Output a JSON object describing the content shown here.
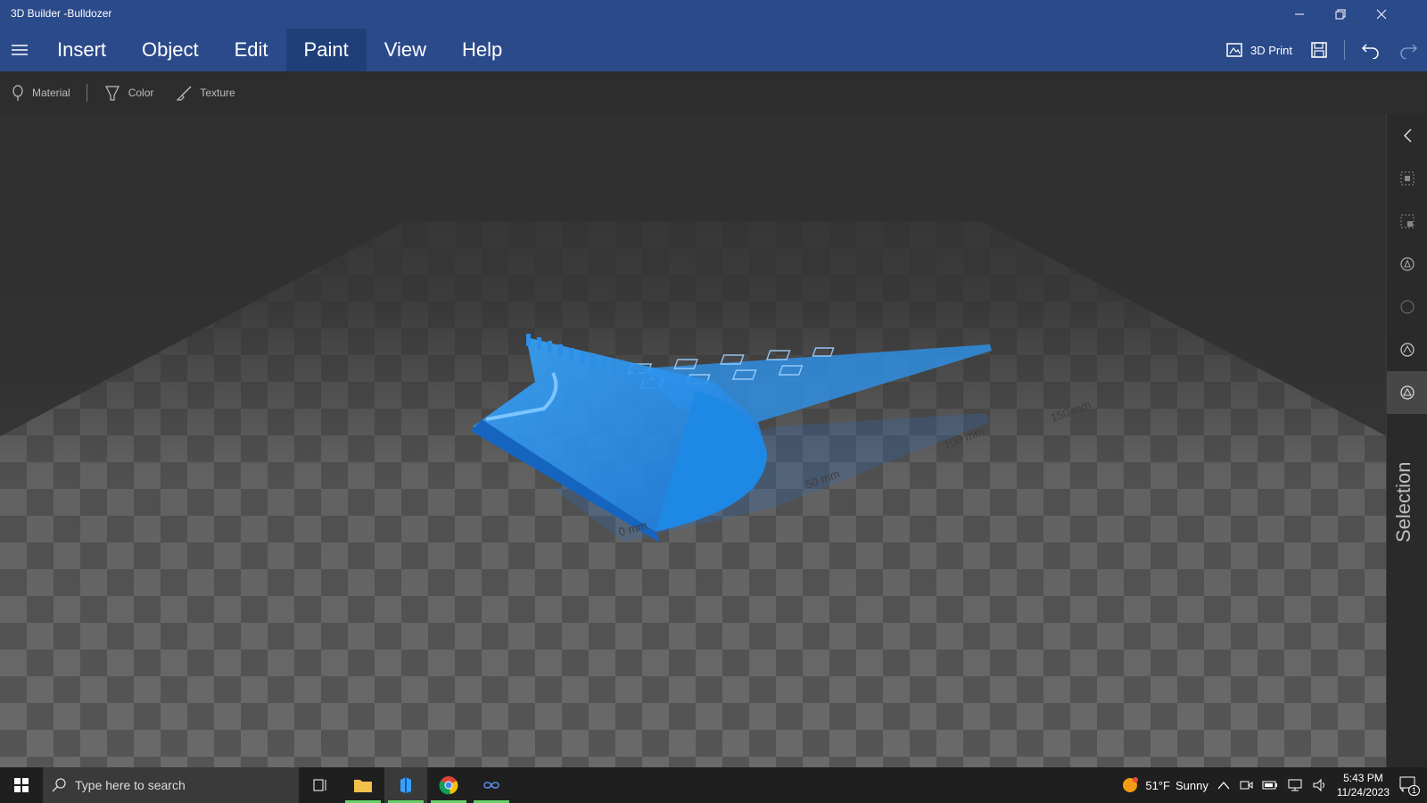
{
  "window": {
    "title": "3D Builder -Bulldozer"
  },
  "menu": [
    {
      "label": "Insert"
    },
    {
      "label": "Object"
    },
    {
      "label": "Edit"
    },
    {
      "label": "Paint",
      "active": true
    },
    {
      "label": "View"
    },
    {
      "label": "Help"
    }
  ],
  "toolbar": {
    "print_label": "3D Print"
  },
  "paint_tools": {
    "material": "Material",
    "color": "Color",
    "texture": "Texture"
  },
  "viewport": {
    "model_color": "#1e90ff",
    "ruler_labels": [
      "50 mm",
      "100 mm",
      "150 mm",
      "0 mm"
    ]
  },
  "right_panel": {
    "label": "Selection"
  },
  "taskbar": {
    "search_placeholder": "Type here to search",
    "weather_temp": "51°F",
    "weather_desc": "Sunny",
    "time": "5:43 PM",
    "date": "11/24/2023",
    "notification_count": "1"
  },
  "colors": {
    "title_bar": "#2b4a8a",
    "active_tab": "#1f3f79",
    "taskbar_active_underline": "#67d067"
  }
}
